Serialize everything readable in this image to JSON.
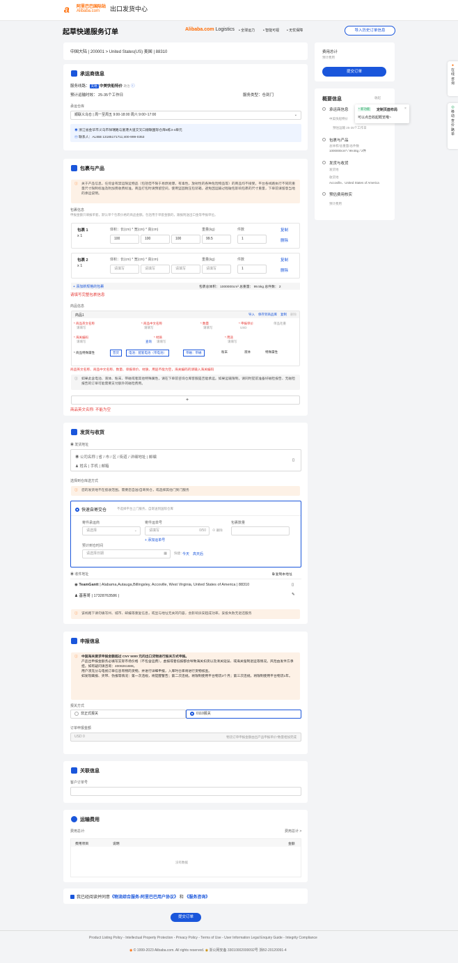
{
  "header": {
    "logo_cn": "阿里巴巴国际站",
    "logo_en": "Alibaba.com",
    "portal": "出口发货中心"
  },
  "page": {
    "title": "起草快递服务订单",
    "brand_a": "Alibaba.com",
    "brand_b": "Logistics",
    "features": [
      "• 全球运力",
      "• 智能可视",
      "• 无忧保障"
    ],
    "history_button": "导入历史订单信息"
  },
  "route": {
    "text": "中国大陆 | 200001 > United States(US) 美国 | 88310"
  },
  "carrier": {
    "title": "承运商信息",
    "line_label": "服务线路：",
    "line_tag": "天地",
    "line_name": "中美快船特价",
    "line_extra": "政治",
    "eta": "预计运输时效： 25-35个工作日",
    "service_type": "服务类型：仓到门",
    "warehouse_label": "承运仓库",
    "warehouse_value": "顺联义乌仓 | 周一至周五 9:00-18:00 周六 9:00~17:00",
    "address": "浙江省金华市义乌市祥瑞路与富港大道交叉口顺联国际仓库5栋3-4单元",
    "contact": "联系人：ALIBB 13185171711;400-999-0353"
  },
  "package": {
    "title": "包裹与产品",
    "notice": "关于产品信息，任何含有禁运限运物品（包括但不限于易燃易爆，有毒性，放射性的各种危险物品等）的商品均不接受。平台各线路执行不同的重量尺寸限制标准及附加费收费标准。商品打包时请预留空间，使用坚固耐压包装箱，避免因运输过程破包影响包裹的尺寸重量，下单前请留意当地的承运说明。",
    "info_label": "包裹信息",
    "info_desc": "申报金额只填报单套，默认单个包裹价格的商品金额。包括用于单套金额的，跟报附送出口金等申报单位。",
    "items": [
      {
        "name": "包裹 1",
        "qty": "x 1",
        "dim_label": "体积：长(cm) * 宽(cm) * 高(cm)",
        "l": "100",
        "w": "100",
        "h": "100",
        "weight_label": "重量(kg)",
        "weight": "99.5",
        "count_label": "件数",
        "count": "1",
        "copy": "复制",
        "delete": "删除"
      },
      {
        "name": "包裹 2",
        "qty": "x 1",
        "dim_label": "体积：长(cm) * 宽(cm) * 高(cm)",
        "l": "请填写",
        "w": "请填写",
        "h": "请填写",
        "weight_label": "重量(kg)",
        "weight": "请填写",
        "count_label": "件数",
        "count": "1",
        "copy": "复制",
        "delete": "删除"
      }
    ],
    "add_link": "+ 添加新规格的包裹",
    "summary": "包裹总体积： 1000000cm³    总重量： 99.5kg    总件数： 2",
    "error": "请填写完整包裹信息",
    "goods_label": "商品信息",
    "goods_name": "商品1",
    "goods_actions": [
      "导入",
      "保存到商品库",
      "复制",
      "删除"
    ],
    "fields": {
      "en_name": "* 商品英文名称",
      "cn_name": "* 商品中文名称",
      "qty": "* 数量",
      "price": "* 申报单价",
      "weight": "单品毛重",
      "hs": "* 海关编码",
      "material": "* 材质",
      "use": "* 用途",
      "placeholder": "请填写",
      "currency": "USD",
      "query": "查询",
      "attrs_label": "* 商品特殊属性",
      "attr_tags": [
        "普货",
        "电池：配套电池（带电池）",
        "带磁：带磁",
        "粉末",
        "液体",
        "特殊属性"
      ]
    },
    "goods_error": "商品英文名称、商品中文名称、数量、单报单价、材质、用途不能为空，海关编码的请输入海关编码",
    "goods_notice": "如果此含电池、液体、粉末、带磁或者其他特殊属性，请在下单前咨询仓库客服是否能承运。如果运输限制，请同时提前准备好磁检报告、无磁检报告的订单可能需要支付额外的磁检费用。",
    "plus": "+",
    "en_error": "商品英文名称: 不能为空"
  },
  "shipping": {
    "title": "发货与收货",
    "from_label": "发货地址",
    "from_line1": "公司名称 | 省 / 市 / 区 / 街道 / 详细地址 | 邮编",
    "from_line2": "姓名 | 手机 | 邮箱",
    "method_label": "选择到仓库送方式",
    "method_notice": "您的发货地不在揽收范围。需要您自送/自寄到仓，或选择其他门到门服务",
    "method_option": "快速自寄交仓",
    "method_desc": "不选择平台上门服务，自寄送到国际仓库",
    "courier_label": "寄件承运商",
    "courier_ph": "请选择",
    "tracking_label": "寄件运单号",
    "tracking_ph": "请填写",
    "tracking_count": "0/50",
    "pkg_count_label": "包裹数量",
    "add_tracking": "+ 添加运单号",
    "date_label": "预计到仓时间",
    "date_ph": "请选择日期",
    "shortcut": "快捷：",
    "today": "今天",
    "after": "高天后",
    "to_label": "收件地址",
    "copy_addr": "复制本地址",
    "company": "TeamGantt",
    "to_address": "| Alabama,Autauga,Billingsley, Accoville, West Virginia, United States of America | 88310",
    "recipient": "基客哥 | 17328763586 |",
    "to_notice": "该线路下请勿填写州、城市、邮编等重复信息，或显与地址无关的内容，会影响派安超成功率，妥投失败无退还服务"
  },
  "declare": {
    "title": "申报信息",
    "notice1": "中国海关要求申报金额超过 CNY 5000 元的出口货物进行报关方式申报。",
    "notice2": "产品出申报金额务必填写实际市场价格（不包含运费），虚报或者低报都会导致海关扣货以及清关延误、或海关强制退运等情况。风险由发件方承担。如有疑问请咨询：4008261688。",
    "notice3": "用户须充分与电视订单信息有物的货物，并进行详细申报，入库时仓库将进行货物核查。",
    "notice4": "如发现瞒报、夹带、伪报等情况：第一次违规，将提醒警告；第二次违规，将限制使用平台物流3个月；第三次违规，将限制使用平台物流1年。",
    "method_label": "报关方式",
    "opt1": "非正式报关",
    "opt2": "0110报关",
    "amount_label": "订单申报金额",
    "amount_ph": "USD  0",
    "check_text": "物流订单申报金额由出产品申报单价*数量相加完成"
  },
  "related": {
    "title": "关联信息",
    "label": "客户订单号"
  },
  "fee": {
    "title": "运输费用",
    "label": "费用总计:",
    "total_link": "费用总计 >",
    "cols": [
      "费用项目",
      "说明",
      "金额"
    ],
    "empty": "没有数据"
  },
  "agree": {
    "text": "我已经阅读并同意",
    "link1": "《物流综合服务-阿里巴巴用户协议》",
    "and": "和",
    "link2": "《服务咨询》"
  },
  "submit": "提交订单",
  "right": {
    "fee_label": "费用总计",
    "fee_sub": "预计费用",
    "submit": "提交订单",
    "summary_title": "概要信息",
    "collapse": "收起",
    "tooltip_tag": "* 新功能",
    "tooltip_title": "定制页面布局",
    "tooltip_text": "可以点击收起概览哦~",
    "steps": [
      {
        "title": "承运商信息",
        "lines": [
          "中美快船特价",
          "预估运输 25-35个工作日"
        ]
      },
      {
        "title": "包裹与产品",
        "lines": [
          "总体积/总重量/总件数",
          "1000000cm³ / 99.5kg / 2件"
        ]
      },
      {
        "title": "发货与收货",
        "lines": [
          "发货地",
          "收货地",
          "Accoville、United States of America"
        ]
      },
      {
        "title": "预估费用核实",
        "lines": [
          "预计费用"
        ]
      }
    ]
  },
  "sidebar": {
    "a": "在线咨询",
    "b": "移动查价路单"
  },
  "footer": {
    "links": "Product Listing Policy - Intellectual Property Protection - Privacy Policy - Terms of Use - User Information Legal Enquiry Guide - Integrity Compliance",
    "copyright": "© 1999-2023 Alibaba.com. All rights reserved.",
    "beian": "浙公网安备 33010002000092号",
    "icp": "浙B2-20120091-4"
  },
  "colors": {
    "primary": "#1a56db",
    "orange": "#ff6a00",
    "red": "#e53935"
  }
}
